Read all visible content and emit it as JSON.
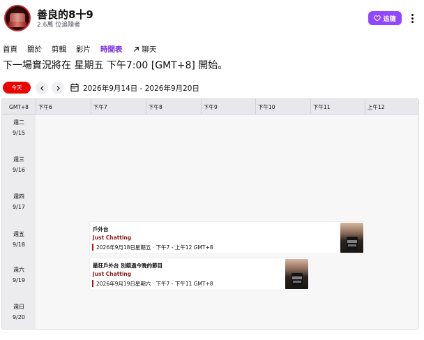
{
  "channel": {
    "name": "善良的8十9",
    "followers": "2.6萬 位追隨者",
    "follow_label": "追隨"
  },
  "tabs": [
    {
      "label": "首頁",
      "active": false
    },
    {
      "label": "關於",
      "active": false
    },
    {
      "label": "剪輯",
      "active": false
    },
    {
      "label": "影片",
      "active": false
    },
    {
      "label": "時間表",
      "active": true
    },
    {
      "label": "聊天",
      "active": false,
      "icon": "arrow-up-right-icon"
    }
  ],
  "next_stream": "下一場實況將在 星期五 下午7:00 [GMT+8] 開始。",
  "toolbar": {
    "today_label": "今天",
    "date_range": "2026年9月14日 - 2026年9月20日"
  },
  "calendar": {
    "timezone": "GMT+8",
    "hours": [
      "下午6",
      "下午7",
      "下午8",
      "下午9",
      "下午10",
      "下午11",
      "上午12"
    ],
    "days": [
      {
        "weekday": "週二",
        "date": "9/15"
      },
      {
        "weekday": "週三",
        "date": "9/16"
      },
      {
        "weekday": "週四",
        "date": "9/17"
      },
      {
        "weekday": "週五",
        "date": "9/18"
      },
      {
        "weekday": "週六",
        "date": "9/19"
      },
      {
        "weekday": "週日",
        "date": "9/20"
      }
    ],
    "events": [
      {
        "title": "戶外台",
        "category": "Just Chatting",
        "time": "2026年9月18日星期五 · 下午7 - 上午12 GMT+8"
      },
      {
        "title": "最狂戶外台 別錯過今晚的節目",
        "category": "Just Chatting",
        "time": "2026年9月19日星期六 · 下午7 - 下午11 GMT+8"
      }
    ]
  },
  "colors": {
    "accent": "#9147ff",
    "active_tab": "#772ce8",
    "today_button": "#eb0400",
    "category": "#8b1a1a"
  }
}
